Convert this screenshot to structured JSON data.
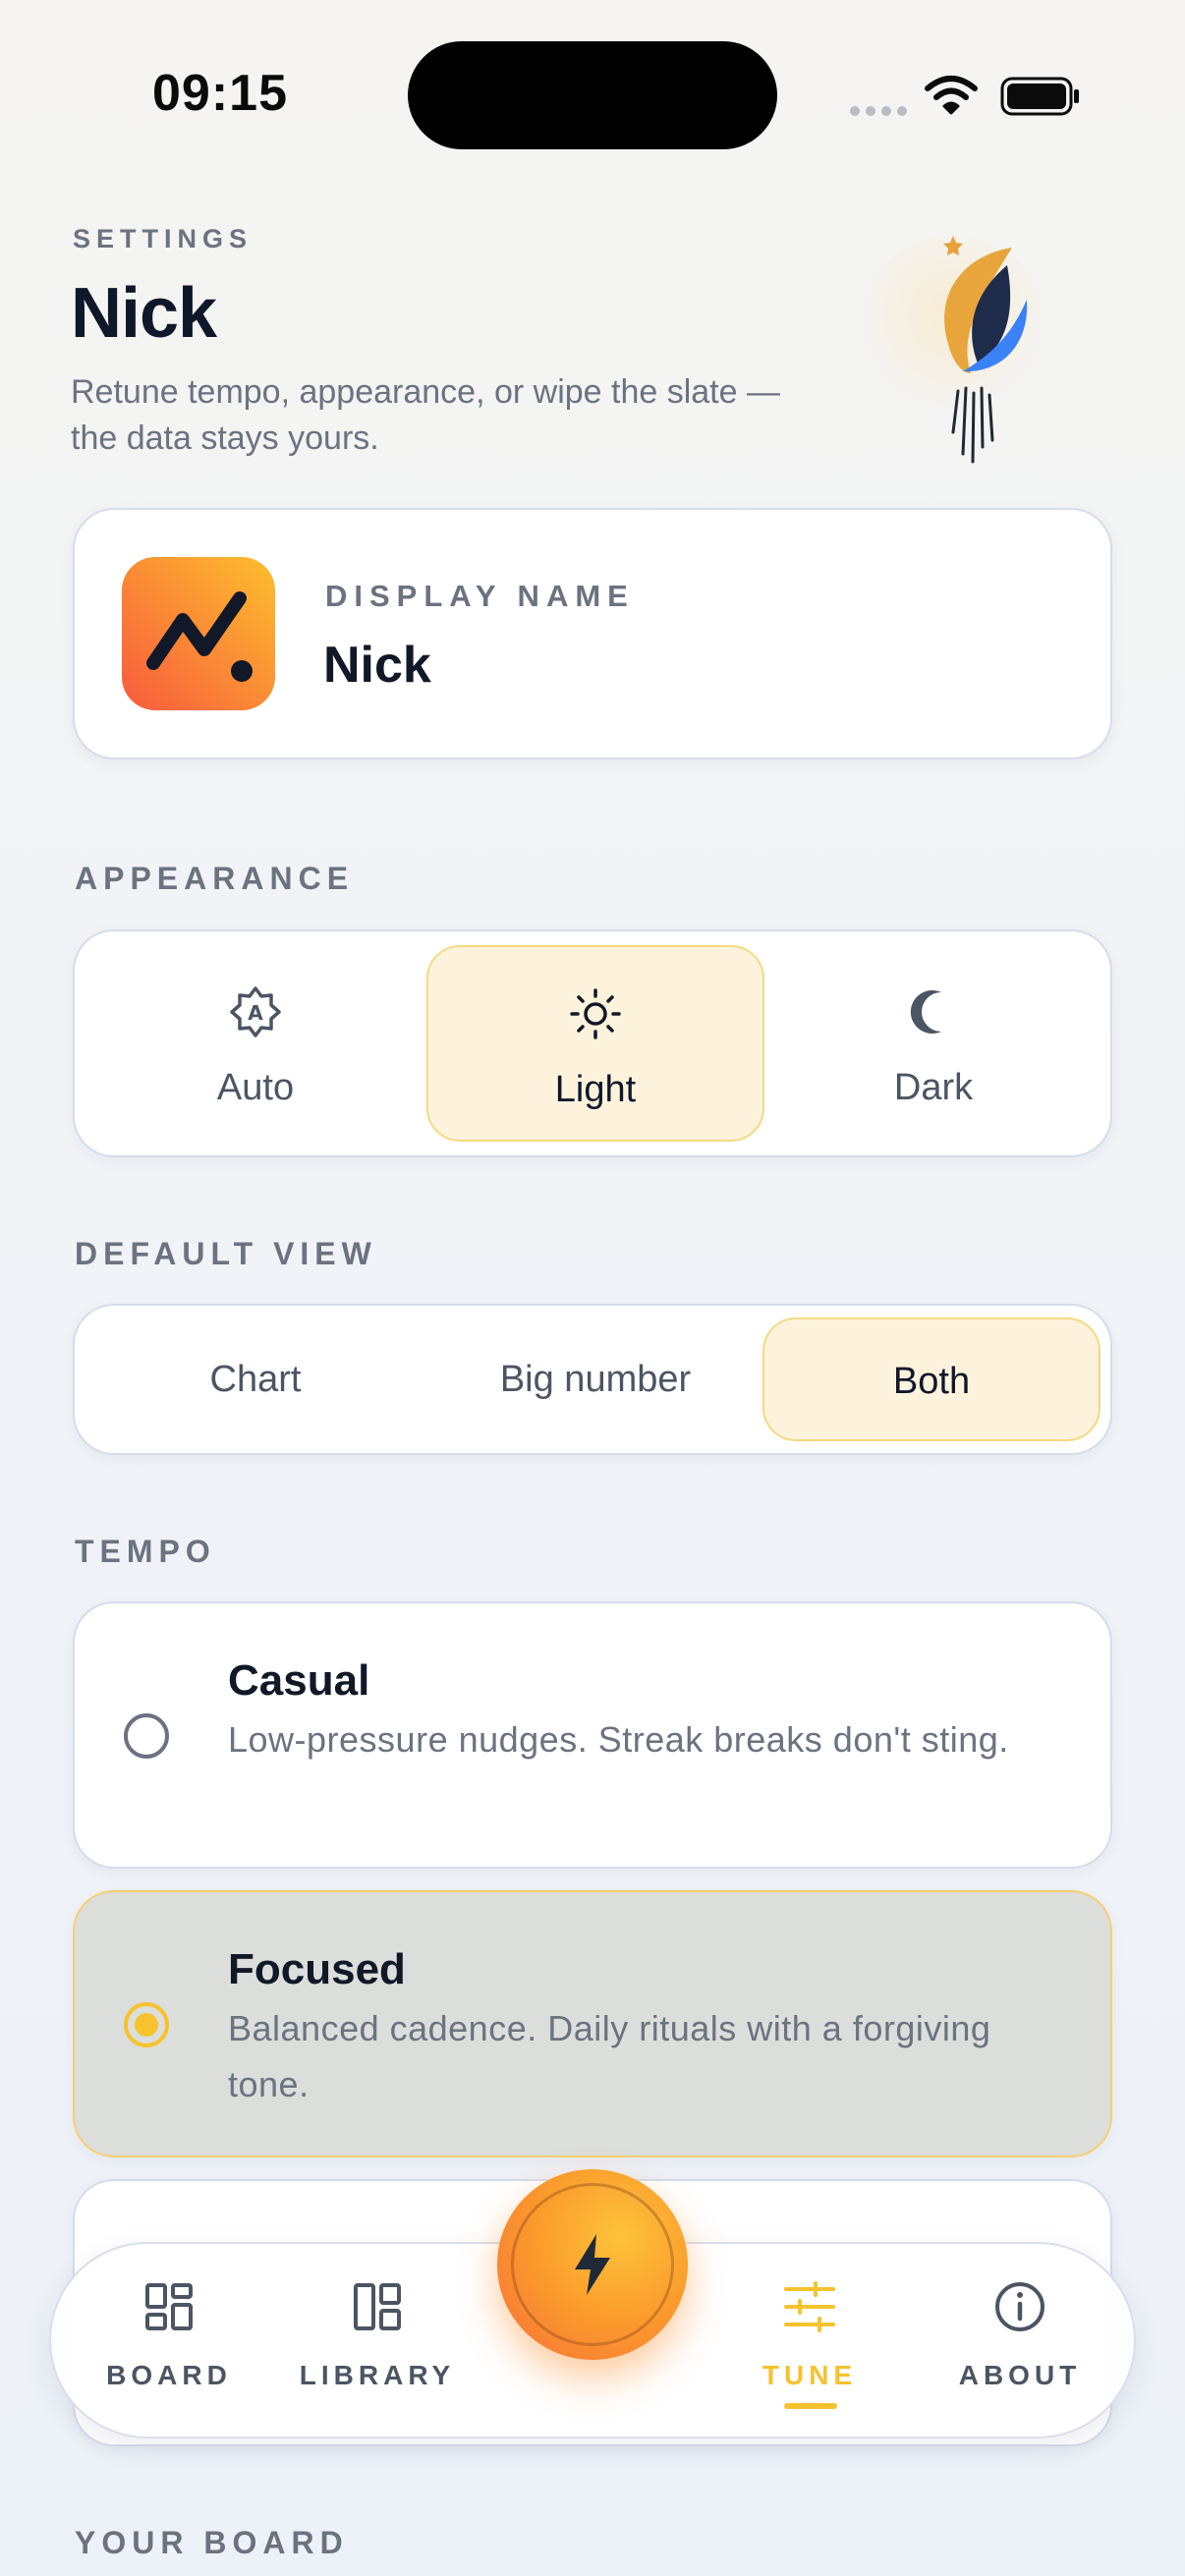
{
  "status_bar": {
    "time": "09:15"
  },
  "header": {
    "eyebrow": "SETTINGS",
    "title": "Nick",
    "subtitle": "Retune tempo, appearance, or wipe the slate — the data stays yours."
  },
  "profile": {
    "label": "DISPLAY NAME",
    "value": "Nick"
  },
  "appearance": {
    "label": "APPEARANCE",
    "options": [
      {
        "label": "Auto",
        "icon": "auto-theme-icon"
      },
      {
        "label": "Light",
        "icon": "sun-icon"
      },
      {
        "label": "Dark",
        "icon": "moon-icon"
      }
    ],
    "selected": "Light"
  },
  "default_view": {
    "label": "DEFAULT VIEW",
    "options": [
      "Chart",
      "Big number",
      "Both"
    ],
    "selected": "Both"
  },
  "tempo": {
    "label": "TEMPO",
    "options": [
      {
        "title": "Casual",
        "description": "Low-pressure nudges. Streak breaks don't sting."
      },
      {
        "title": "Focused",
        "description": "Balanced cadence. Daily rituals with a forgiving tone."
      }
    ],
    "selected": "Focused"
  },
  "nav": {
    "items": [
      {
        "label": "BOARD",
        "icon": "board-icon"
      },
      {
        "label": "LIBRARY",
        "icon": "library-icon"
      },
      {
        "label": "TUNE",
        "icon": "sliders-icon"
      },
      {
        "label": "ABOUT",
        "icon": "info-icon"
      }
    ],
    "active": "TUNE",
    "fab_icon": "lightning-icon"
  },
  "next_section": {
    "label": "YOUR BOARD"
  },
  "colors": {
    "accent": "#f6c22e",
    "accent_soft": "#fdf3dd",
    "fab_orange": "#f86d3a",
    "text_primary": "#111827",
    "text_muted": "#6b7280"
  }
}
